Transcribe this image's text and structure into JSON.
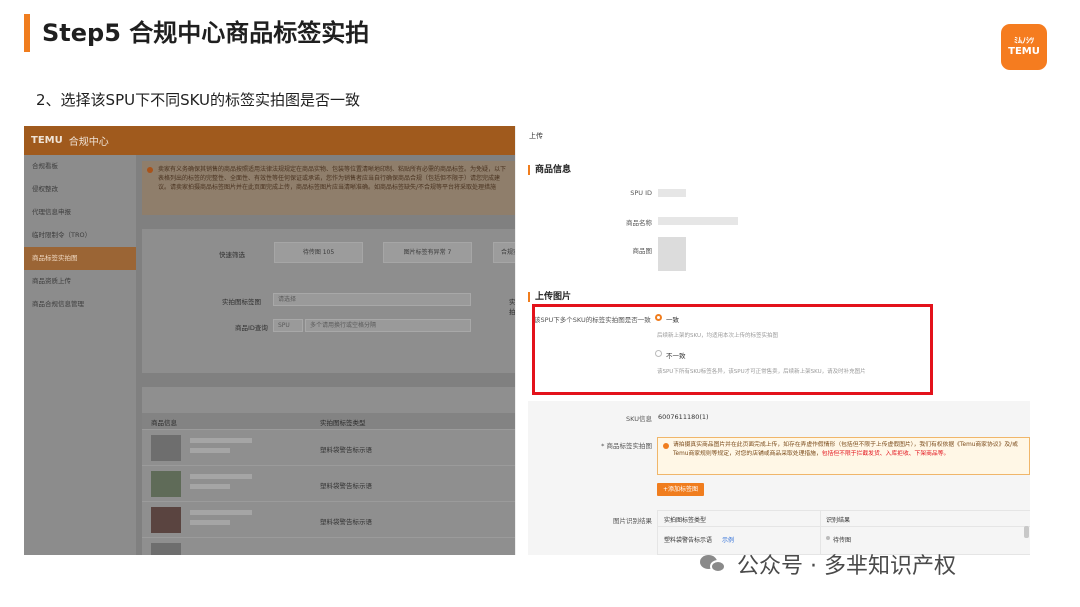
{
  "slide": {
    "title": "Step5 合规中心商品标签实拍",
    "subtitle": "2、选择该SPU下不同SKU的标签实拍图是否一致",
    "logo_top": "ﾐﾑﾉｼﾂ",
    "logo_text": "TEMU",
    "accent_color": "#f07d1e"
  },
  "left_app": {
    "brand": "TEMU",
    "title": "合规中心",
    "sidebar": [
      "合规看板",
      "侵权整改",
      "代理信息申报",
      "临时限制令（TRO）",
      "商品标签实拍图",
      "商品资质上传",
      "商品合规信息管理"
    ],
    "active_index": 4,
    "notice": "卖家有义务确保其销售的商品按照适用法律法规规定在商品实物、包装等位置清晰地印制、粘贴所有必需的商品标签。为免疑，以下表格列出的标签的完整性、全面性、有效性等任何保证或承诺，您作为销售者应当自行确保商品合规（包括但不限于）请您完成建议。请卖家拍摄商品标签图片并在此页面完成上传，商品标签图片应当清晰准确。如商品标签缺失/不合规等平台将采取处理措施",
    "quick_filter_label": "快速筛选",
    "chips": [
      "待传图 105",
      "图片标签有异常 7",
      "合规实拍"
    ],
    "field_labels": [
      "实拍图标签图",
      "商品ID查询",
      "实拍"
    ],
    "select_placeholder": "请选择",
    "spu_label": "SPU",
    "spu_placeholder": "多个请用换行或空格分隔",
    "columns": [
      "商品信息",
      "实拍图标签类型"
    ],
    "rows": [
      {
        "type": "塑料袋警告标示语"
      },
      {
        "type": "塑料袋警告标示语"
      },
      {
        "type": "塑料袋警告标示语"
      }
    ]
  },
  "right_app": {
    "title": "上传",
    "product_section": "商品信息",
    "labels": {
      "spu_id": "SPU ID",
      "name": "商品名称",
      "image": "商品图"
    },
    "upload_section": "上传图片",
    "question": "该SPU下多个SKU的标签实拍图是否一致",
    "option_same": "一致",
    "option_same_hint": "后续新上架的SKU，均适用本次上传的标签实拍图",
    "option_diff": "不一致",
    "option_diff_hint": "该SPU下所有SKU标签各异，该SPU才可正常售卖，后续新上架SKU，请及时补充图片",
    "sku_label": "SKU信息",
    "sku_value": "6007611180(1)",
    "tag_label": "* 商品标签实拍图",
    "warning_main": "请拍摄真实商品图片并在此页面完成上传，如存在弄虚作假情形（包括但不限于上传虚假图片），我们有权依据《Temu商家协议》及/或Temu商家规则等规定，对您的店铺或商品采取处理措施，",
    "warning_red": "包括但不限于拦截发货、入库拒收、下架商品等。",
    "add_button": "+添加标签图",
    "recognition_label": "图片识别结果",
    "table_headers": [
      "实拍图标签类型",
      "识别结果"
    ],
    "table_row": {
      "type": "塑料袋警告标示语",
      "example": "示例",
      "result": "待传图"
    }
  },
  "watermark": {
    "text": "公众号 · 多芈知识产权"
  }
}
